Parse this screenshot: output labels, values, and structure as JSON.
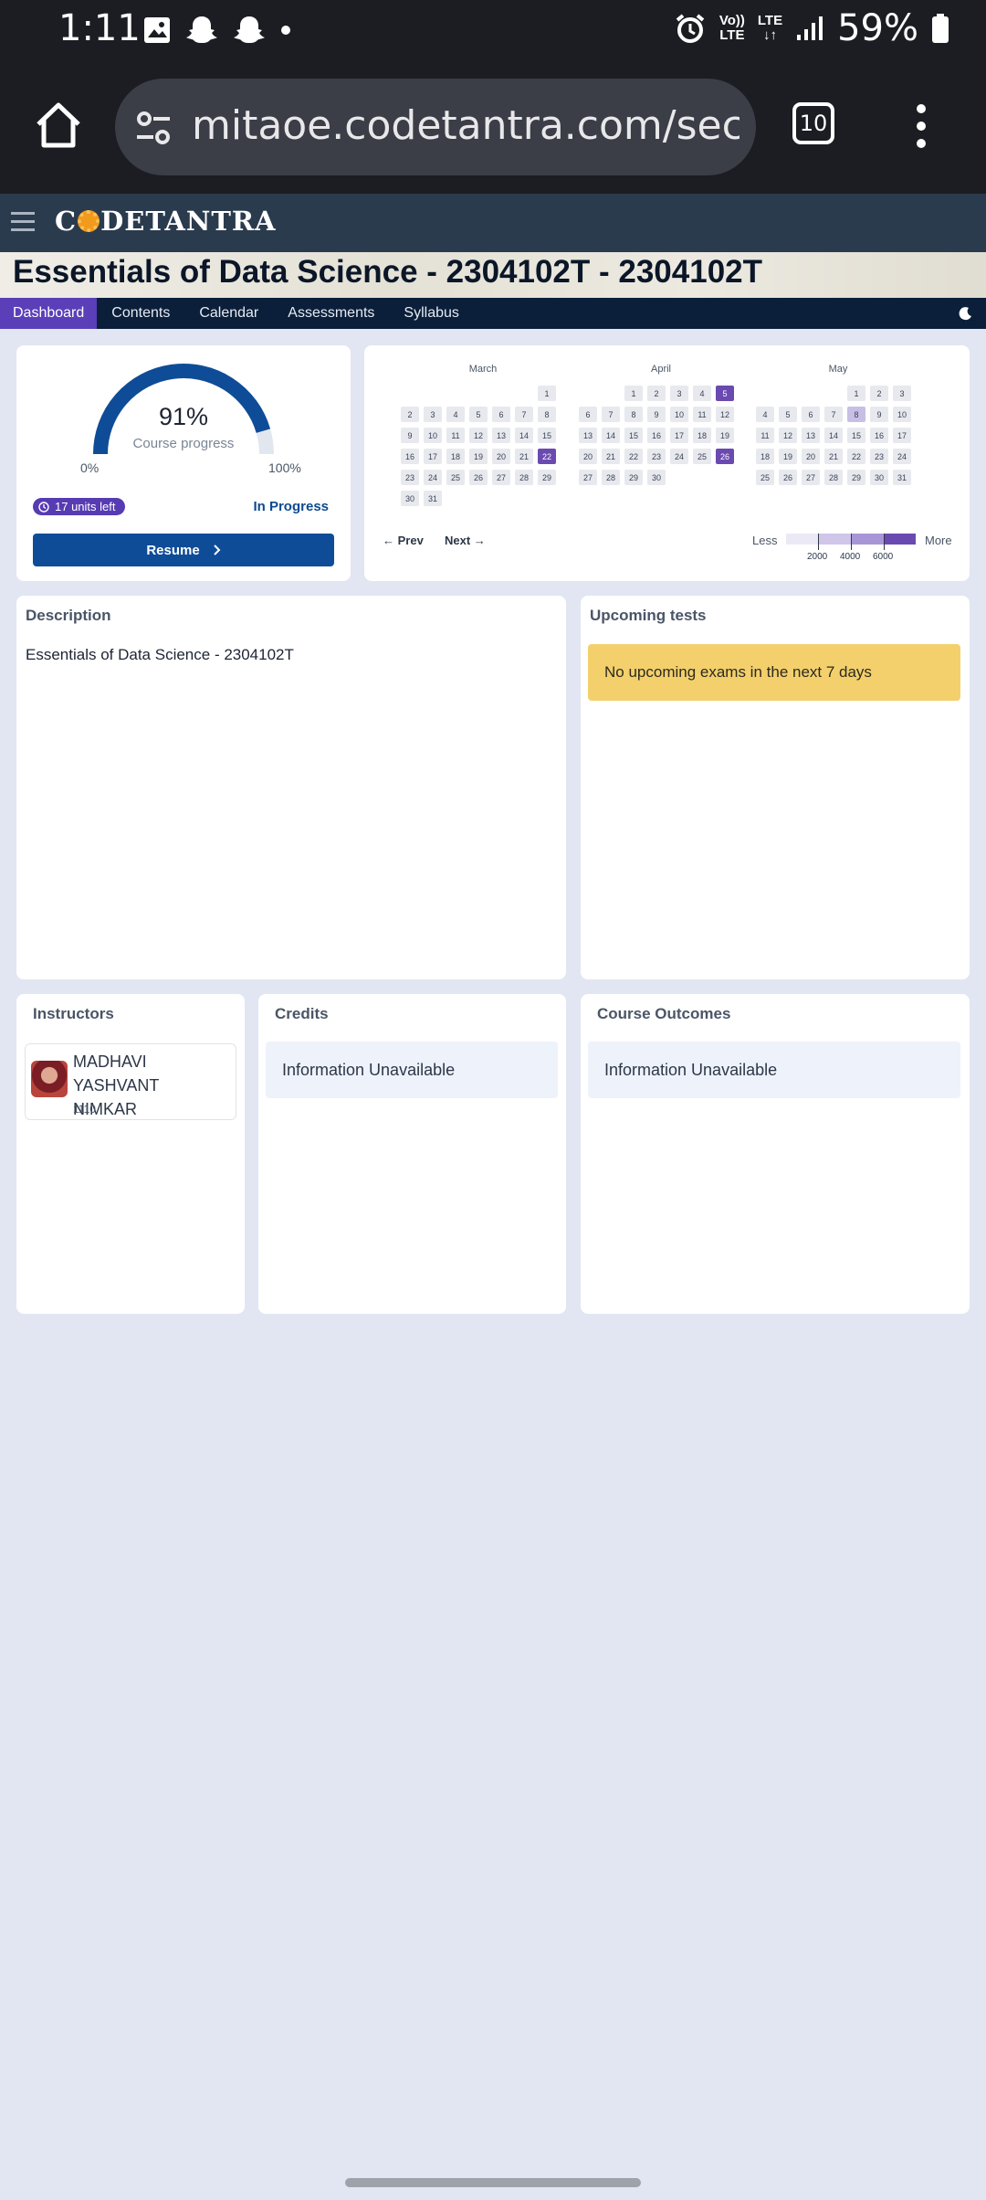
{
  "status_bar": {
    "time": "1:11",
    "volte_top": "Vo))",
    "volte_bottom": "LTE",
    "lte_top": "LTE",
    "lte_bottom": "↓↑",
    "battery": "59%"
  },
  "browser": {
    "url": "mitaoe.codetantra.com/secure/",
    "tab_count": "10"
  },
  "app": {
    "logo": "CODETANTRA",
    "course_title": "Essentials of Data Science - 2304102T - 2304102T",
    "tabs": [
      "Dashboard",
      "Contents",
      "Calendar",
      "Assessments",
      "Syllabus"
    ],
    "active_tab": "Dashboard"
  },
  "progress": {
    "percent": 91,
    "percent_label": "91%",
    "label": "Course progress",
    "min_label": "0%",
    "max_label": "100%",
    "units_left": "17 units left",
    "status": "In Progress",
    "resume_label": "Resume"
  },
  "calendar": {
    "months": [
      {
        "name": "March",
        "offset": 6,
        "days": 31,
        "active": {
          "22": 3
        }
      },
      {
        "name": "April",
        "offset": 2,
        "days": 30,
        "active": {
          "5": 3,
          "26": 3
        }
      },
      {
        "name": "May",
        "offset": 4,
        "days": 31,
        "active": {
          "8": 1
        }
      }
    ],
    "prev_label": "Prev",
    "next_label": "Next",
    "legend_less": "Less",
    "legend_more": "More",
    "legend_ticks": [
      "2000",
      "4000",
      "6000"
    ],
    "legend_colors": [
      "#ece9f6",
      "#cfc6ea",
      "#a795d8",
      "#6a4ab0"
    ]
  },
  "description": {
    "title": "Description",
    "text": "Essentials of Data Science - 2304102T"
  },
  "upcoming": {
    "title": "Upcoming tests",
    "message": "No upcoming exams in the next 7 days"
  },
  "instructors": {
    "title": "Instructors",
    "name_line1": "MADHAVI YASHVANT",
    "name_line2": "NIMKAR",
    "id": "1110"
  },
  "credits": {
    "title": "Credits",
    "message": "Information Unavailable"
  },
  "course_outcomes": {
    "title": "Course Outcomes",
    "message": "Information Unavailable"
  },
  "colors": {
    "accent": "#5a3fb8",
    "primary": "#0f4c97",
    "warning": "#f3d06c"
  }
}
